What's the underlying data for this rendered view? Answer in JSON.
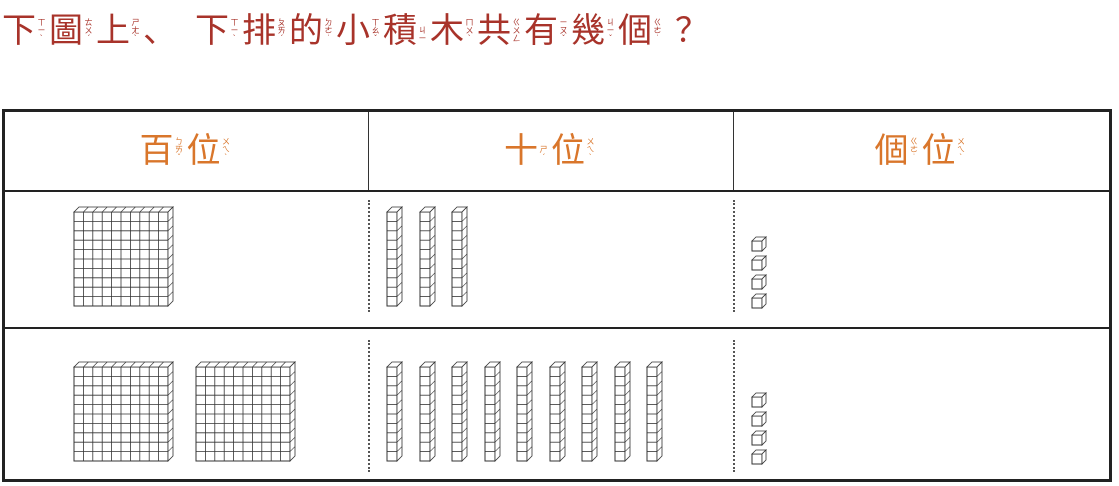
{
  "colors": {
    "question": "#a8332a",
    "header": "#d9762b",
    "lines": "#222222"
  },
  "question": {
    "segments": [
      {
        "type": "word",
        "hz": "下",
        "zy": [
          "ㄒ",
          "ㄧ",
          "ˋ"
        ]
      },
      {
        "type": "word",
        "hz": "圖",
        "zy": [
          "ㄊ",
          "ㄨ",
          "ˊ"
        ]
      },
      {
        "type": "word",
        "hz": "上",
        "zy": [
          "ㄕ",
          "ㄤ",
          "ˋ"
        ]
      },
      {
        "type": "punct",
        "text": "、"
      },
      {
        "type": "word",
        "hz": "下",
        "zy": [
          "ㄒ",
          "ㄧ",
          "ˋ"
        ]
      },
      {
        "type": "word",
        "hz": "排",
        "zy": [
          "ㄆ",
          "ㄞ",
          "ˊ"
        ]
      },
      {
        "type": "word",
        "hz": "的",
        "zy": [
          "ㄉ",
          "ㄜ",
          "˙"
        ]
      },
      {
        "type": "word",
        "hz": "小",
        "zy": [
          "ㄒ",
          "ㄠ",
          "ˇ"
        ]
      },
      {
        "type": "word",
        "hz": "積",
        "zy": [
          "ㄐ",
          "ㄧ"
        ]
      },
      {
        "type": "word",
        "hz": "木",
        "zy": [
          "ㄇ",
          "ㄨ",
          "ˋ"
        ]
      },
      {
        "type": "word",
        "hz": "共",
        "zy": [
          "ㄍ",
          "ㄨ",
          "ㄥ"
        ]
      },
      {
        "type": "word",
        "hz": "有",
        "zy": [
          "ㄧ",
          "ㄡ",
          "ˇ"
        ]
      },
      {
        "type": "word",
        "hz": "幾",
        "zy": [
          "ㄐ",
          "ㄧ",
          "ˇ"
        ]
      },
      {
        "type": "word",
        "hz": "個",
        "zy": [
          "ㄍ",
          "ㄜ",
          "˙"
        ]
      },
      {
        "type": "qmark",
        "text": "？"
      }
    ]
  },
  "table": {
    "headers": [
      {
        "id": "hundreds",
        "chars": [
          {
            "hz": "百",
            "zy": [
              "ㄅ",
              "ㄞ",
              "ˇ"
            ]
          },
          {
            "hz": "位",
            "zy": [
              "ㄨ",
              "ㄟ",
              "ˋ"
            ]
          }
        ]
      },
      {
        "id": "tens",
        "chars": [
          {
            "hz": "十",
            "zy": [
              "ㄕ",
              "ˊ"
            ]
          },
          {
            "hz": "位",
            "zy": [
              "ㄨ",
              "ㄟ",
              "ˋ"
            ]
          }
        ]
      },
      {
        "id": "ones",
        "chars": [
          {
            "hz": "個",
            "zy": [
              "ㄍ",
              "ㄜ",
              "˙"
            ]
          },
          {
            "hz": "位",
            "zy": [
              "ㄨ",
              "ㄟ",
              "ˋ"
            ]
          }
        ]
      }
    ],
    "rows": [
      {
        "id": "upper",
        "hundreds": 1,
        "tens": 3,
        "ones": 4
      },
      {
        "id": "lower",
        "hundreds": 2,
        "tens": 9,
        "ones": 4
      }
    ]
  }
}
